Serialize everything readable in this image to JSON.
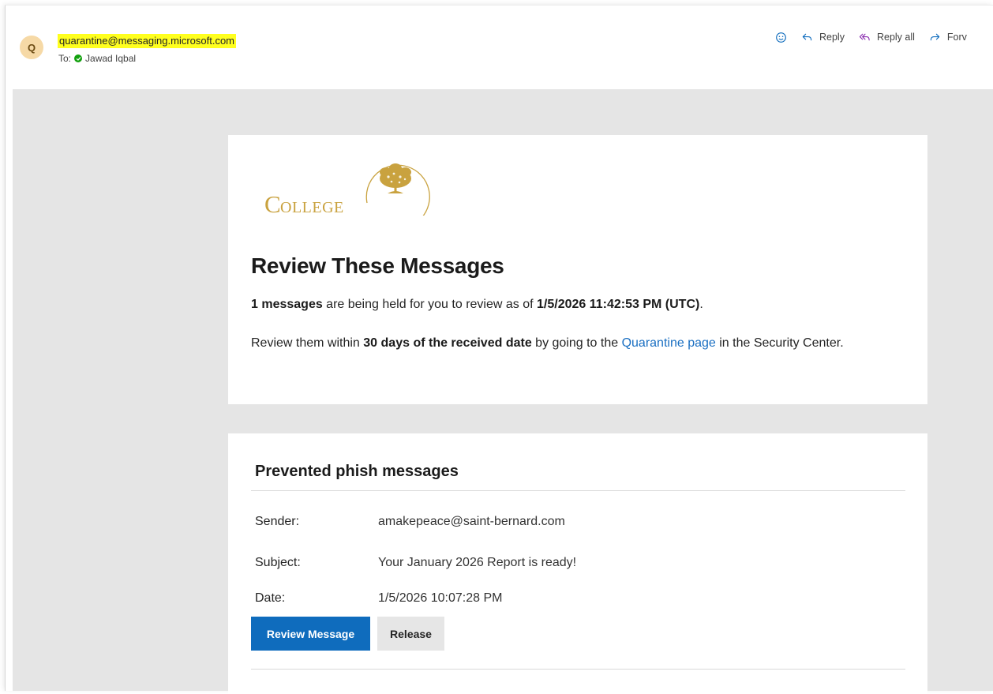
{
  "header": {
    "avatar_initial": "Q",
    "from": "quarantine@messaging.microsoft.com",
    "to_label": "To:",
    "to_name": "Jawad Iqbal"
  },
  "toolbar": {
    "reply_label": "Reply",
    "reply_all_label": "Reply all",
    "forward_label": "Forv"
  },
  "logo": {
    "text": "COLLEGE"
  },
  "summary": {
    "heading": "Review These Messages",
    "count": "1 messages",
    "held_text": " are being held for you to review as of ",
    "as_of": "1/5/2026 11:42:53 PM (UTC)",
    "end_punct": ".",
    "review_prefix": " Review them within ",
    "deadline": "30 days of the received date",
    "review_mid": " by going to the ",
    "quarantine_link": "Quarantine page",
    "review_suffix": " in the Security Center."
  },
  "section": {
    "title": "Prevented phish messages",
    "sender_label": "Sender:",
    "sender_value": "amakepeace@saint-bernard.com",
    "subject_label": "Subject:",
    "subject_value": "Your January 2026 Report is ready!",
    "date_label": "Date:",
    "date_value": "1/5/2026 10:07:28 PM",
    "review_button": "Review Message",
    "release_button": "Release"
  },
  "colors": {
    "highlight": "#ffff1e",
    "primary_button": "#0f6cbd",
    "link": "#1a6fc2",
    "logo_gold": "#c9a23f",
    "body_background": "#e5e5e5"
  }
}
